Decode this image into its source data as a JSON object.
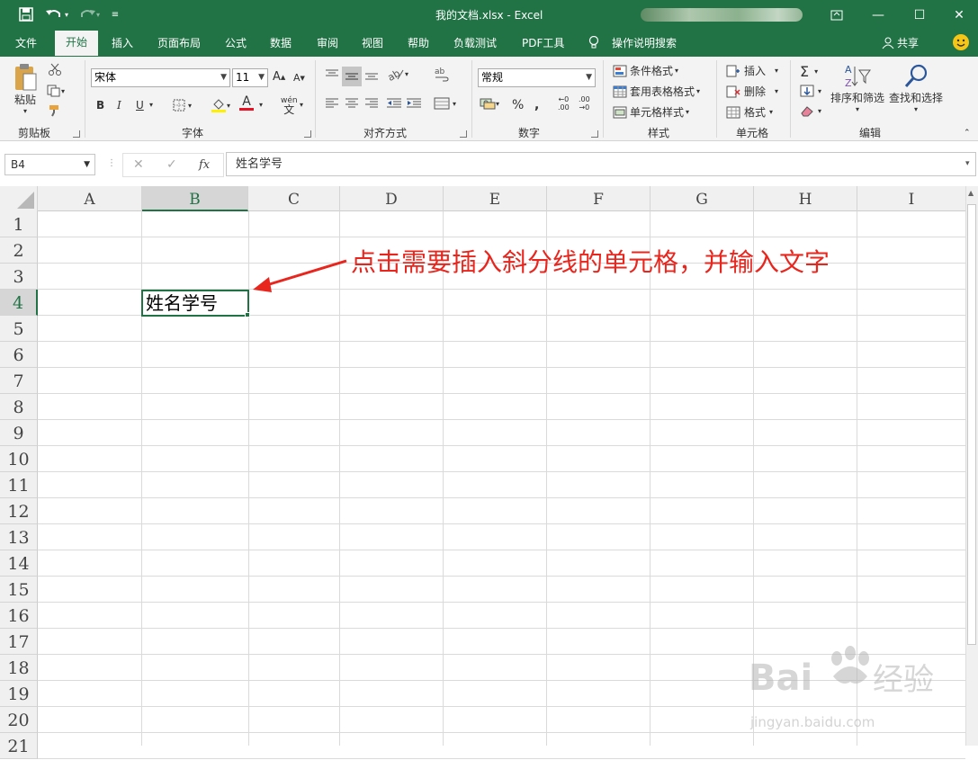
{
  "window": {
    "title": "我的文档.xlsx  -  Excel",
    "accent": "#217346",
    "controls": [
      "ribbon-display-icon",
      "minimize-icon",
      "maximize-icon",
      "close-icon"
    ]
  },
  "quick_access": [
    "save-icon",
    "undo-icon",
    "redo-icon",
    "customize-icon"
  ],
  "tabs": [
    {
      "label": "文件"
    },
    {
      "label": "开始",
      "active": true
    },
    {
      "label": "插入"
    },
    {
      "label": "页面布局"
    },
    {
      "label": "公式"
    },
    {
      "label": "数据"
    },
    {
      "label": "审阅"
    },
    {
      "label": "视图"
    },
    {
      "label": "帮助"
    },
    {
      "label": "负载测试"
    },
    {
      "label": "PDF工具"
    },
    {
      "label": "操作说明搜索"
    }
  ],
  "share_label": "共享",
  "ribbon": {
    "clipboard": {
      "paste": "粘贴",
      "label": "剪贴板"
    },
    "font": {
      "name": "宋体",
      "size": "11",
      "bold": "B",
      "italic": "I",
      "underline": "U",
      "label": "字体"
    },
    "alignment": {
      "label": "对齐方式"
    },
    "number": {
      "format": "常规",
      "percent": "%",
      "label": "数字"
    },
    "styles": {
      "conditional": "条件格式",
      "table": "套用表格格式",
      "cell": "单元格样式",
      "label": "样式"
    },
    "cells": {
      "insert": "插入",
      "delete": "删除",
      "format": "格式",
      "label": "单元格"
    },
    "editing": {
      "sort": "排序和筛选",
      "find": "查找和选择",
      "label": "编辑"
    }
  },
  "formula_bar": {
    "name_box": "B4",
    "fx": "fx",
    "content": "姓名学号"
  },
  "columns": [
    "A",
    "B",
    "C",
    "D",
    "E",
    "F",
    "G",
    "H",
    "I"
  ],
  "rows": [
    "1",
    "2",
    "3",
    "4",
    "5",
    "6",
    "7",
    "8",
    "9",
    "10",
    "11",
    "12",
    "13",
    "14",
    "15",
    "16",
    "17",
    "18",
    "19",
    "20",
    "21"
  ],
  "selected_cell": {
    "ref": "B4",
    "value": "姓名学号"
  },
  "annotation": {
    "text": "点击需要插入斜分线的单元格，并输入文字",
    "color": "#e8261e"
  },
  "watermark": {
    "brand": "Baidu经验",
    "url": "jingyan.baidu.com"
  }
}
